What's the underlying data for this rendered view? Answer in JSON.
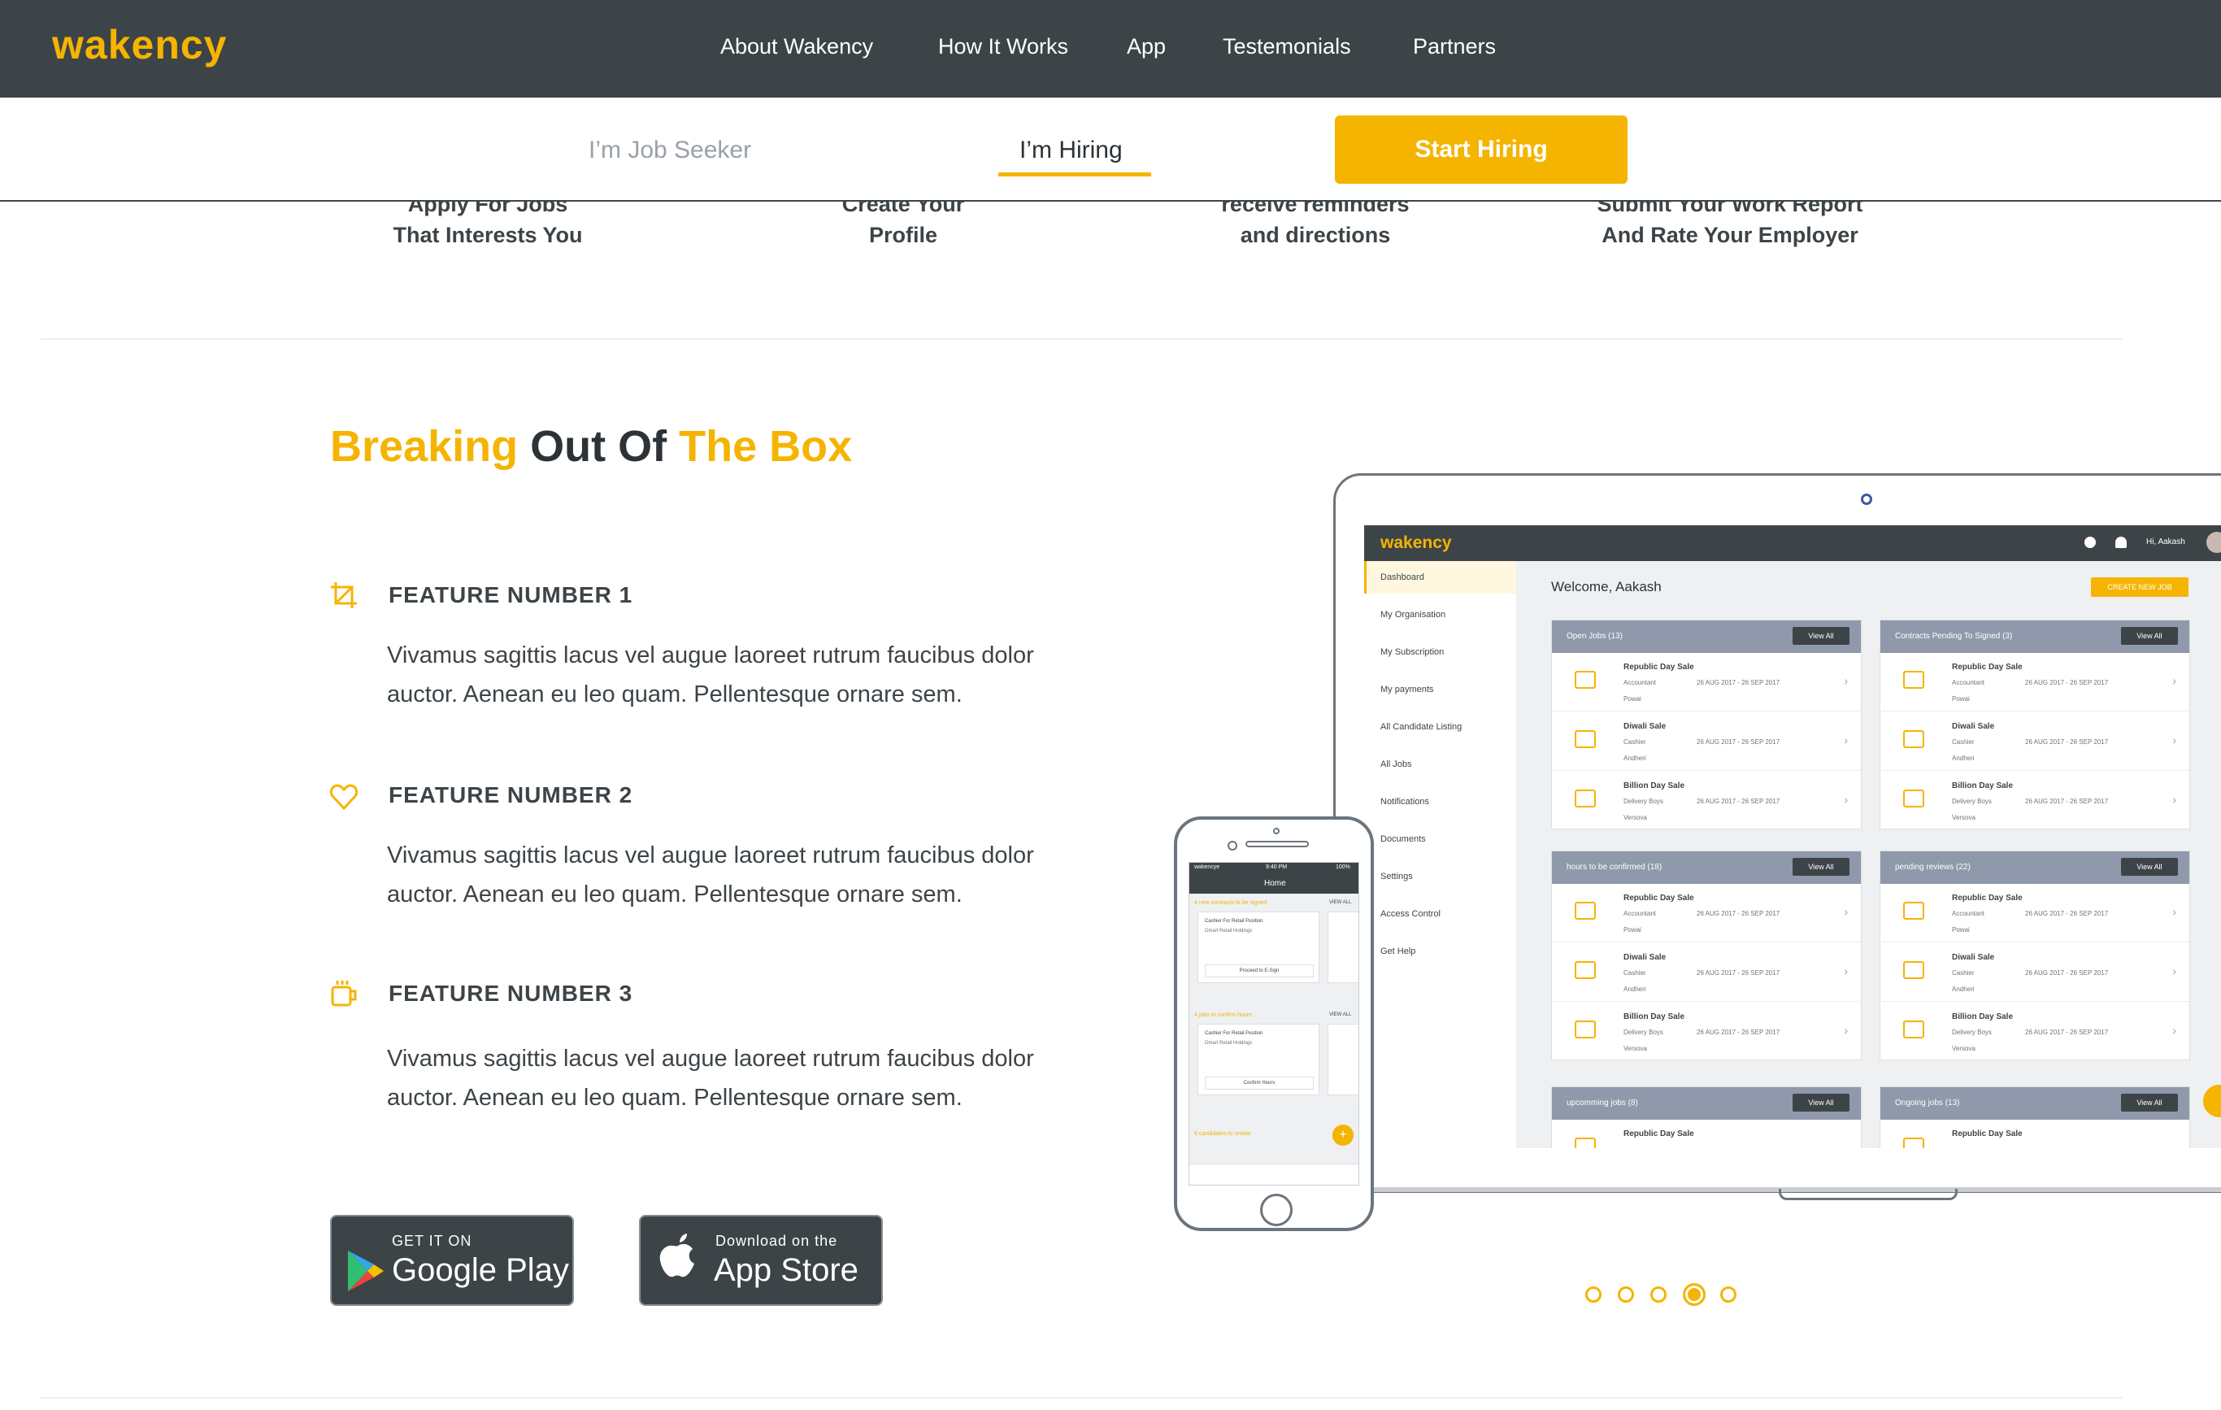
{
  "brand": {
    "logo": "wakency",
    "accent": "#f5b400",
    "dark": "#3d4448"
  },
  "topnav": {
    "items": [
      "About Wakency",
      "How It Works",
      "App",
      "Testemonials",
      "Partners"
    ]
  },
  "subnav": {
    "job_seeker": "I’m Job Seeker",
    "hiring": "I’m Hiring",
    "start_hiring": "Start Hiring",
    "active": "I’m Hiring"
  },
  "steps": [
    {
      "line1": "Apply For Jobs",
      "line2": "That Interests You"
    },
    {
      "line1": "Create Your",
      "line2": "Profile"
    },
    {
      "line1": "receive reminders",
      "line2": "and directions"
    },
    {
      "line1": "Submit Your Work Report",
      "line2": "And Rate Your Employer"
    }
  ],
  "section": {
    "title_part1": "Breaking",
    "title_part2": "Out Of",
    "title_part3": "The Box"
  },
  "features": [
    {
      "icon": "crop-icon",
      "title": "FEATURE NUMBER 1",
      "desc": "Vivamus sagittis lacus vel augue laoreet rutrum faucibus dolor auctor. Aenean eu leo quam. Pellentesque ornare sem."
    },
    {
      "icon": "heart-icon",
      "title": "FEATURE NUMBER 2",
      "desc": "Vivamus sagittis lacus vel augue laoreet rutrum faucibus dolor auctor. Aenean eu leo quam. Pellentesque ornare sem."
    },
    {
      "icon": "mug-icon",
      "title": "FEATURE NUMBER 3",
      "desc": "Vivamus sagittis lacus vel augue laoreet rutrum faucibus dolor auctor. Aenean eu leo quam. Pellentesque ornare sem."
    }
  ],
  "stores": {
    "google": {
      "small": "GET IT ON",
      "big": "Google Play"
    },
    "apple": {
      "small": "Download on the",
      "big": "App Store"
    }
  },
  "dashboard": {
    "logo": "wakency",
    "user": "Hi, Aakash",
    "welcome": "Welcome, Aakash",
    "create_job": "CREATE NEW JOB",
    "sidebar": [
      "Dashboard",
      "My Organisation",
      "My Subscription",
      "My payments",
      "All Candidate Listing",
      "All Jobs",
      "Notifications",
      "Documents",
      "Settings",
      "Access Control",
      "Get Help"
    ],
    "view_all": "View All",
    "cards": [
      {
        "title": "Open Jobs (13)"
      },
      {
        "title": "Contracts Pending To Signed (3)"
      },
      {
        "title": "hours to be confirmed (18)"
      },
      {
        "title": "pending reviews (22)"
      },
      {
        "title": "upcomming jobs (8)"
      },
      {
        "title": "Ongoing jobs (13)"
      }
    ],
    "rows": [
      {
        "name": "Republic Day Sale",
        "role": "Accountant",
        "dates": "26 AUG 2017 - 26 SEP 2017",
        "place": "Powai"
      },
      {
        "name": "Diwali Sale",
        "role": "Cashier",
        "dates": "26 AUG 2017 - 26 SEP 2017",
        "place": "Andheri"
      },
      {
        "name": "Billion Day Sale",
        "role": "Delivery Boys",
        "dates": "26 AUG 2017 - 26 SEP 2017",
        "place": "Versova"
      }
    ]
  },
  "phone": {
    "status": "wakencye",
    "time": "9:40 PM",
    "battery": "100%",
    "title": "Home",
    "sec1": "4 new contracts to be signed",
    "sec2": "4 jobs to confirm hours",
    "sec3": "6 candidates to review",
    "view_all": "VIEW ALL",
    "job": "Cashier For Retail Position",
    "company": "Dmart Retail Holdings",
    "btn1": "Proceed to E-Sign",
    "btn2": "Confirm Hours"
  },
  "carousel": {
    "count": 5,
    "active": 4
  }
}
